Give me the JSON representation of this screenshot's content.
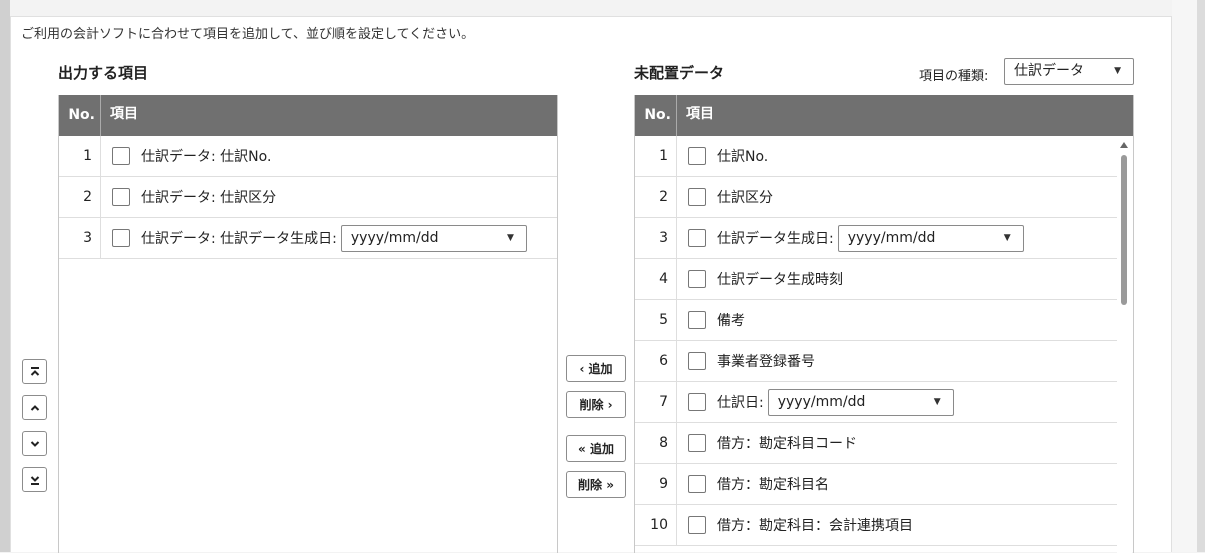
{
  "instruction": "ご利用の会計ソフトに合わせて項目を追加して、並び順を設定してください。",
  "output_section": {
    "title": "出力する項目",
    "header_no": "No.",
    "header_item": "項目",
    "rows": [
      {
        "no": "1",
        "label": "仕訳データ: 仕訳No."
      },
      {
        "no": "2",
        "label": "仕訳データ: 仕訳区分"
      },
      {
        "no": "3",
        "label": "仕訳データ: 仕訳データ生成日:",
        "select_value": "yyyy/mm/dd"
      }
    ]
  },
  "unplaced_section": {
    "title": "未配置データ",
    "type_label": "項目の種類:",
    "type_value": "仕訳データ",
    "header_no": "No.",
    "header_item": "項目",
    "rows": [
      {
        "no": "1",
        "label": "仕訳No."
      },
      {
        "no": "2",
        "label": "仕訳区分"
      },
      {
        "no": "3",
        "label": "仕訳データ生成日:",
        "select_value": "yyyy/mm/dd"
      },
      {
        "no": "4",
        "label": "仕訳データ生成時刻"
      },
      {
        "no": "5",
        "label": "備考"
      },
      {
        "no": "6",
        "label": "事業者登録番号"
      },
      {
        "no": "7",
        "label": "仕訳日:",
        "select_value": "yyyy/mm/dd"
      },
      {
        "no": "8",
        "label": "借方：勘定科目コード"
      },
      {
        "no": "9",
        "label": "借方：勘定科目名"
      },
      {
        "no": "10",
        "label": "借方：勘定科目：会計連携項目"
      }
    ]
  },
  "transfer_buttons": {
    "add": "‹ 追加",
    "remove": "削除 ›",
    "add_all": "« 追加",
    "remove_all": "削除 »"
  },
  "icons": {
    "move_top": "chevron-double-up-icon",
    "move_up": "chevron-up-icon",
    "move_down": "chevron-down-icon",
    "move_bottom": "chevron-double-down-icon",
    "dropdown": "caret-down-icon"
  },
  "colors": {
    "table_header_bg": "#707070",
    "table_header_text": "#ffffff",
    "panel_bg": "#ffffff",
    "page_bg": "#f3f3f3"
  }
}
